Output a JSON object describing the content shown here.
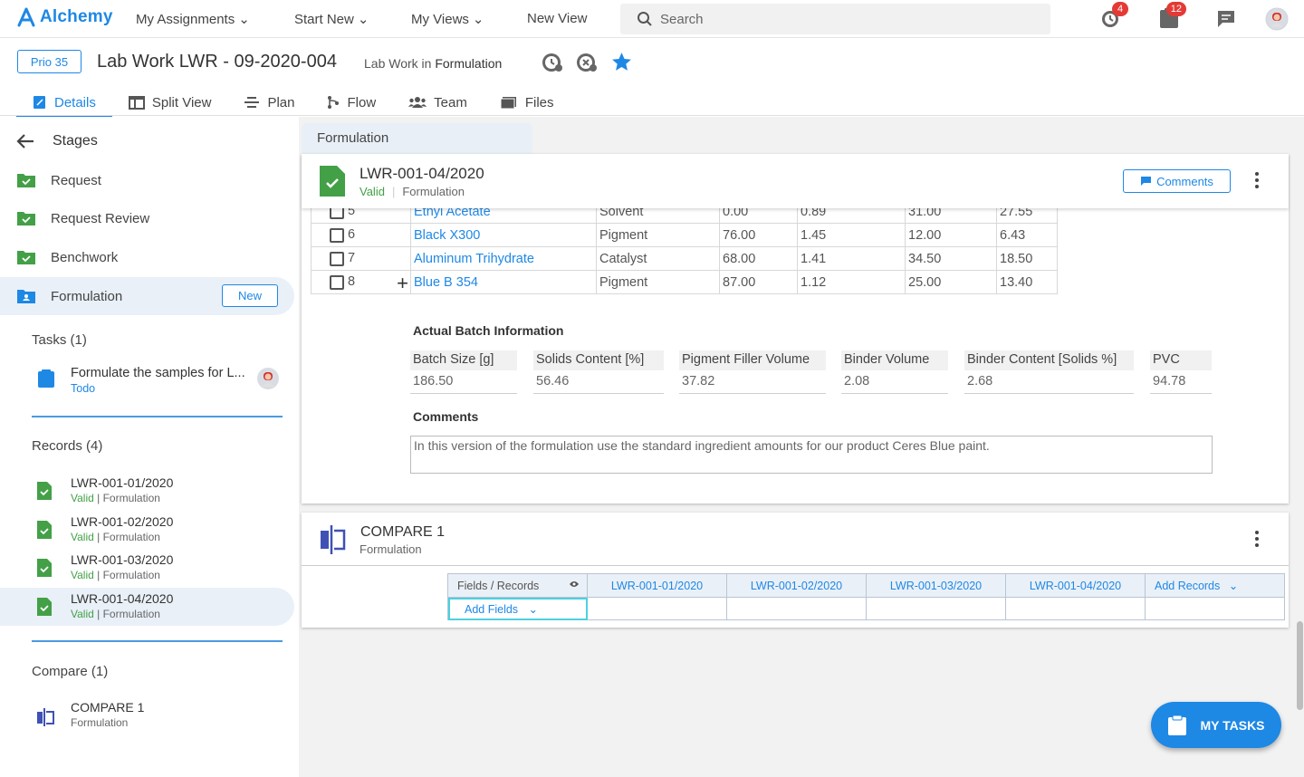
{
  "brand": "Alchemy",
  "nav": {
    "my_assignments": "My Assignments",
    "start_new": "Start New",
    "my_views": "My Views",
    "new_view": "New View",
    "search_placeholder": "Search"
  },
  "badges": {
    "recent": "4",
    "tasks": "12"
  },
  "header": {
    "prio": "Prio 35",
    "title": "Lab Work LWR - 09-2020-004",
    "subtitle_prefix": "Lab Work in",
    "subtitle_stage": "Formulation"
  },
  "tabs": [
    "Details",
    "Split View",
    "Plan",
    "Flow",
    "Team",
    "Files"
  ],
  "sidebar": {
    "stages_title": "Stages",
    "stages": [
      "Request",
      "Request Review",
      "Benchwork",
      "Formulation"
    ],
    "new_label": "New",
    "tasks_title": "Tasks (1)",
    "task": {
      "name": "Formulate the samples for L...",
      "status": "Todo"
    },
    "records_title": "Records (4)",
    "records": [
      {
        "name": "LWR-001-01/2020",
        "status": "Valid",
        "stage": "| Formulation"
      },
      {
        "name": "LWR-001-02/2020",
        "status": "Valid",
        "stage": "| Formulation"
      },
      {
        "name": "LWR-001-03/2020",
        "status": "Valid",
        "stage": "| Formulation"
      },
      {
        "name": "LWR-001-04/2020",
        "status": "Valid",
        "stage": "| Formulation"
      }
    ],
    "compare_title": "Compare (1)",
    "compare": {
      "name": "COMPARE 1",
      "stage": "Formulation"
    }
  },
  "main": {
    "tab": "Formulation",
    "record": {
      "name": "LWR-001-04/2020",
      "status": "Valid",
      "stage": "Formulation",
      "comments_btn": "Comments"
    },
    "ingredients": [
      {
        "num": "5",
        "name": "Ethyl Acetate",
        "type": "Solvent",
        "c1": "0.00",
        "c2": "0.89",
        "c3": "31.00",
        "c4": "27.55"
      },
      {
        "num": "6",
        "name": "Black X300",
        "type": "Pigment",
        "c1": "76.00",
        "c2": "1.45",
        "c3": "12.00",
        "c4": "6.43"
      },
      {
        "num": "7",
        "name": "Aluminum Trihydrate",
        "type": "Catalyst",
        "c1": "68.00",
        "c2": "1.41",
        "c3": "34.50",
        "c4": "18.50"
      },
      {
        "num": "8",
        "name": "Blue B 354",
        "type": "Pigment",
        "c1": "87.00",
        "c2": "1.12",
        "c3": "25.00",
        "c4": "13.40"
      }
    ],
    "batch_title": "Actual Batch Information",
    "batch": [
      {
        "label": "Batch Size [g]",
        "value": "186.50"
      },
      {
        "label": "Solids Content [%]",
        "value": "56.46"
      },
      {
        "label": "Pigment Filler Volume",
        "value": "37.82"
      },
      {
        "label": "Binder Volume",
        "value": "2.08"
      },
      {
        "label": "Binder Content [Solids %]",
        "value": "2.68"
      },
      {
        "label": "PVC",
        "value": "94.78"
      }
    ],
    "comments_title": "Comments",
    "comments_text": "In this version of the formulation use the standard ingredient amounts for our product Ceres Blue paint.",
    "compare": {
      "title": "COMPARE 1",
      "stage": "Formulation",
      "fields_records": "Fields / Records",
      "records": [
        "LWR-001-01/2020",
        "LWR-001-02/2020",
        "LWR-001-03/2020",
        "LWR-001-04/2020"
      ],
      "add_records": "Add Records",
      "add_fields": "Add Fields"
    }
  },
  "my_tasks": "MY TASKS",
  "colors": {
    "accent": "#1e88e5",
    "valid": "#43a047",
    "badge": "#e53935"
  }
}
